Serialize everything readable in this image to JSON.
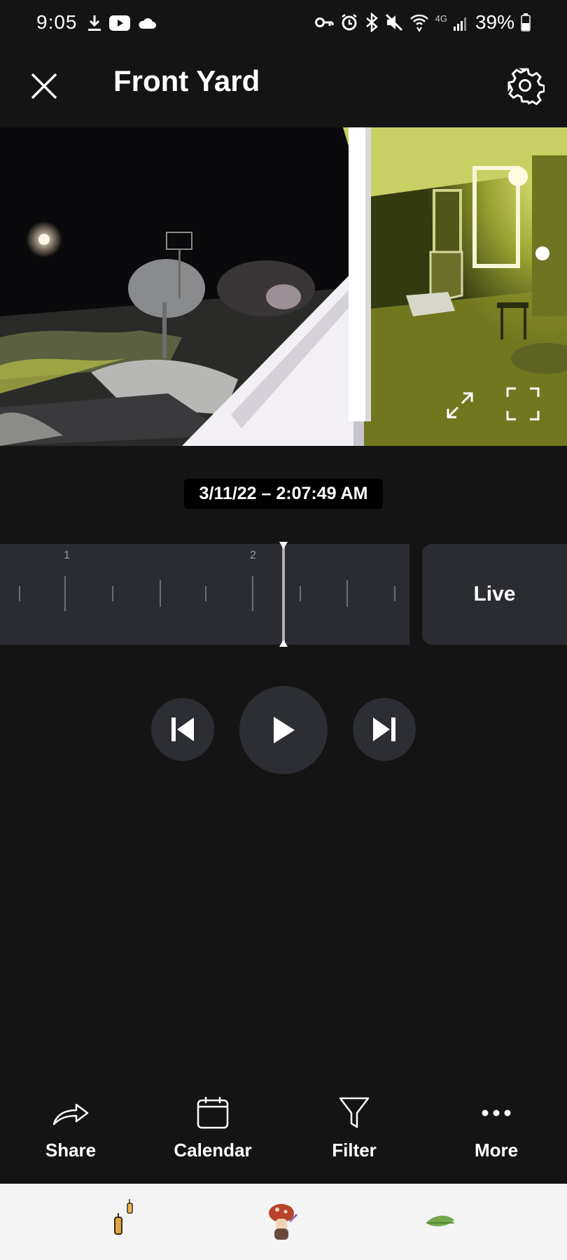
{
  "status_bar": {
    "time": "9:05",
    "network_label": "4G",
    "battery": "39%",
    "left_icons": [
      "download-icon",
      "youtube-icon",
      "cloud-icon"
    ],
    "right_icons": [
      "vpn-key-icon",
      "alarm-icon",
      "bluetooth-icon",
      "mute-icon",
      "wifi-icon",
      "signal-icon",
      "battery-icon"
    ]
  },
  "header": {
    "title": "Front Yard",
    "close_icon": "close-icon",
    "settings_icon": "gear-icon"
  },
  "video": {
    "expand_icon": "expand-arrows-icon",
    "fullscreen_icon": "fullscreen-icon"
  },
  "timestamp": "3/11/22 – 2:07:49 AM",
  "timeline": {
    "tick_labels": [
      "1",
      "2"
    ],
    "live_label": "Live"
  },
  "playback": {
    "prev_icon": "skip-previous-icon",
    "play_icon": "play-icon",
    "next_icon": "skip-next-icon"
  },
  "actions": [
    {
      "label": "Share",
      "icon": "share-icon"
    },
    {
      "label": "Calendar",
      "icon": "calendar-icon"
    },
    {
      "label": "Filter",
      "icon": "filter-icon"
    },
    {
      "label": "More",
      "icon": "more-icon"
    }
  ],
  "tray": {
    "items": [
      "lantern-icon",
      "mushroom-character-icon",
      "leaf-icon"
    ]
  },
  "colors": {
    "background": "#141414",
    "panel": "#2a2c31",
    "night_vision_tint": "#d8e35a"
  }
}
